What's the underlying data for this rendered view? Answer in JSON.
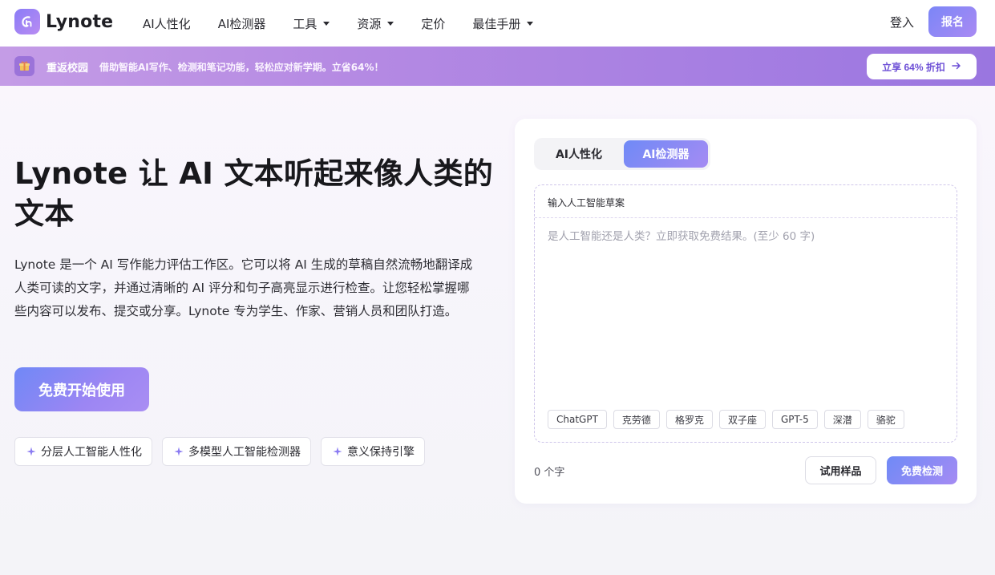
{
  "brand": {
    "name": "Lynote",
    "accent": "#7b86f7",
    "accent2": "#a98af3"
  },
  "nav": {
    "items": [
      {
        "label": "AI人性化",
        "dropdown": false
      },
      {
        "label": "AI检测器",
        "dropdown": false
      },
      {
        "label": "工具",
        "dropdown": true
      },
      {
        "label": "资源",
        "dropdown": true
      },
      {
        "label": "定价",
        "dropdown": false
      },
      {
        "label": "最佳手册",
        "dropdown": true
      }
    ],
    "login": "登入",
    "signup": "报名"
  },
  "banner": {
    "title": "重返校园",
    "text": "借助智能AI写作、检测和笔记功能，轻松应对新学期。立省64%！",
    "cta": "立享 64% 折扣"
  },
  "hero": {
    "title": "Lynote 让 AI 文本听起来像人类的文本",
    "description": "Lynote 是一个 AI 写作能力评估工作区。它可以将 AI 生成的草稿自然流畅地翻译成人类可读的文字，并通过清晰的 AI 评分和句子高亮显示进行检查。让您轻松掌握哪些内容可以发布、提交或分享。Lynote 专为学生、作家、营销人员和团队打造。",
    "cta": "免费开始使用",
    "features": [
      "分层人工智能人性化",
      "多模型人工智能检测器",
      "意义保持引擎"
    ]
  },
  "card": {
    "tabs": {
      "humanize": "AI人性化",
      "detector": "AI检测器",
      "active": "detector"
    },
    "editor": {
      "label": "输入人工智能草案",
      "value": "",
      "placeholder": "是人工智能还是人类？立即获取免费结果。(至少 60 字)"
    },
    "models": [
      "ChatGPT",
      "克劳德",
      "格罗克",
      "双子座",
      "GPT-5",
      "深潜",
      "骆驼"
    ],
    "count": "0 个字",
    "sample_button": "试用样品",
    "detect_button": "免费检测"
  }
}
